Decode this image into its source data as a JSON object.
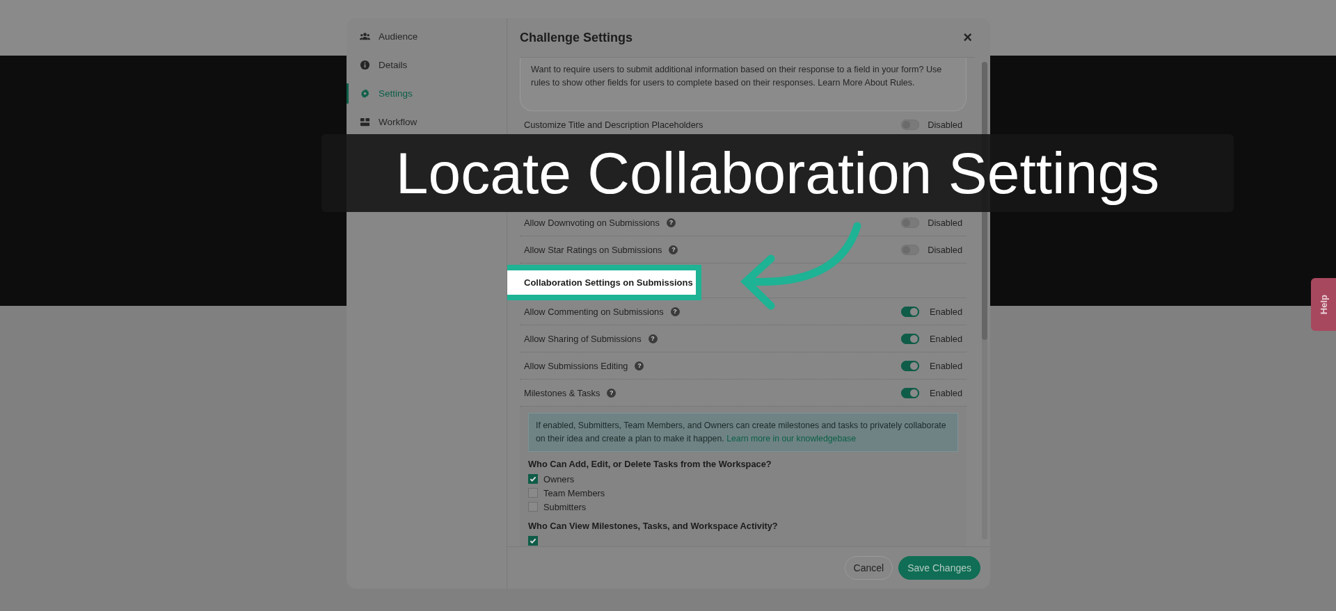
{
  "sidebar": {
    "items": [
      {
        "label": "Audience",
        "selected": false
      },
      {
        "label": "Details",
        "selected": false
      },
      {
        "label": "Settings",
        "selected": true
      },
      {
        "label": "Workflow",
        "selected": false
      }
    ]
  },
  "dialog": {
    "title": "Challenge Settings",
    "close": "×",
    "rules_note": "Want to require users to submit additional information based on their response to a field in your form? Use rules to show other fields for users to complete based on their responses. Learn More About Rules.",
    "settings": [
      {
        "kind": "toggle",
        "label": "Customize Title and Description Placeholders",
        "on": false,
        "status": "Disabled"
      },
      {
        "kind": "toggle",
        "label": "Allow Downvoting on Submissions",
        "help": "?",
        "on": false,
        "status": "Disabled"
      },
      {
        "kind": "toggle",
        "label": "Allow Star Ratings on Submissions",
        "help": "?",
        "on": false,
        "status": "Disabled"
      },
      {
        "kind": "heading",
        "label": "Collaboration Settings on Submissions",
        "highlighted": true
      },
      {
        "kind": "toggle",
        "label": "Allow Commenting on Submissions",
        "help": "?",
        "on": true,
        "status": "Enabled"
      },
      {
        "kind": "toggle",
        "label": "Allow Sharing of Submissions",
        "help": "?",
        "on": true,
        "status": "Enabled"
      },
      {
        "kind": "toggle",
        "label": "Allow Submissions Editing",
        "help": "?",
        "on": true,
        "status": "Enabled"
      },
      {
        "kind": "toggle",
        "label": "Milestones & Tasks",
        "help": "?",
        "on": true,
        "status": "Enabled"
      }
    ],
    "milestones_panel": {
      "info": "If enabled, Submitters, Team Members, and Owners can create milestones and tasks to privately collaborate on their idea and create a plan to make it happen.",
      "link": "Learn more in our knowledgebase",
      "groups": [
        {
          "title": "Who Can Add, Edit, or Delete Tasks from the Workspace?",
          "options": [
            {
              "label": "Owners",
              "checked": true
            },
            {
              "label": "Team Members",
              "checked": false
            },
            {
              "label": "Submitters",
              "checked": false
            }
          ]
        },
        {
          "title": "Who Can View Milestones, Tasks, and Workspace Activity?",
          "options": [
            {
              "checked": true
            }
          ]
        }
      ]
    },
    "buttons": [
      {
        "label": "Cancel",
        "kind": "secondary"
      },
      {
        "label": "Save Changes",
        "kind": "primary"
      }
    ]
  },
  "caption": "Locate Collaboration Settings",
  "help_tab": "Help"
}
